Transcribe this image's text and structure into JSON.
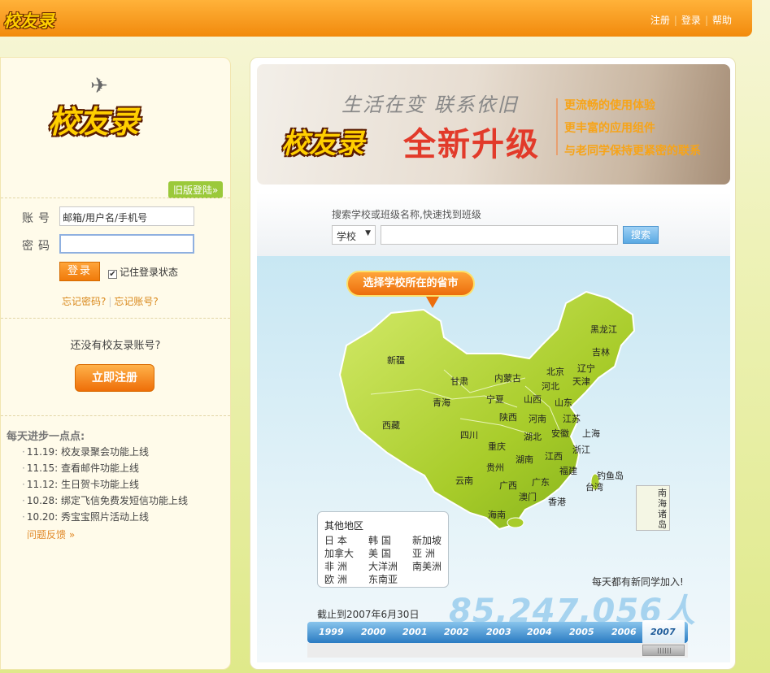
{
  "topbar": {
    "logo": "校友录",
    "links": [
      "注册",
      "登录",
      "帮助"
    ]
  },
  "login": {
    "logo": "校友录",
    "old_login": "旧版登陆»",
    "account_label": "账号",
    "account_value": "邮箱/用户名/手机号",
    "password_label": "密码",
    "password_value": "",
    "login_button": "登录",
    "remember": "记住登录状态",
    "forgot_password": "忘记密码?",
    "forgot_account": "忘记账号?"
  },
  "signup": {
    "prompt": "还没有校友录账号?",
    "button": "立即注册"
  },
  "news": {
    "title": "每天进步一点点:",
    "items": [
      "11.19: 校友录聚会功能上线",
      "11.15: 查看邮件功能上线",
      "11.12: 生日贺卡功能上线",
      "10.28: 绑定飞信免费发短信功能上线",
      "10.20: 秀宝宝照片活动上线"
    ],
    "feedback": "问题反馈 »"
  },
  "banner": {
    "slogan": "生活在变 联系依旧",
    "logo": "校友录",
    "headline": "全新升级",
    "features": [
      "更流畅的使用体验",
      "更丰富的应用组件",
      "与老同学保持更紧密的联系"
    ]
  },
  "search": {
    "hint": "搜索学校或班级名称,快速找到班级",
    "select_value": "学校",
    "input_value": "",
    "button": "搜索"
  },
  "map": {
    "title": "选择学校所在的省市",
    "provinces": [
      "黑龙江",
      "吉林",
      "辽宁",
      "北京",
      "天津",
      "内蒙古",
      "河北",
      "新疆",
      "甘肃",
      "青海",
      "宁夏",
      "山西",
      "山东",
      "西藏",
      "陕西",
      "河南",
      "江苏",
      "四川",
      "湖北",
      "安徽",
      "上海",
      "重庆",
      "浙江",
      "江西",
      "湖南",
      "贵州",
      "福建",
      "云南",
      "广西",
      "广东",
      "钓鱼岛",
      "台湾",
      "澳门",
      "香港",
      "海南"
    ],
    "south_sea": "南海诸岛",
    "other_title": "其他地区",
    "other_regions": [
      "日 本",
      "韩 国",
      "新加坡",
      "加拿大",
      "美 国",
      "亚 洲",
      "非 洲",
      "大洋洲",
      "南美洲",
      "欧 洲",
      "东南亚"
    ],
    "daily": "每天都有新同学加入!",
    "count": "85,247,056人",
    "as_of": "截止到2007年6月30日",
    "years": [
      "1999",
      "2000",
      "2001",
      "2002",
      "2003",
      "2004",
      "2005",
      "2006",
      "2007"
    ],
    "selected_year": "2007"
  },
  "colors": {
    "brand_orange": "#f28a0c",
    "map_green": "#a8cc2a",
    "headline_red": "#e23a2a"
  }
}
